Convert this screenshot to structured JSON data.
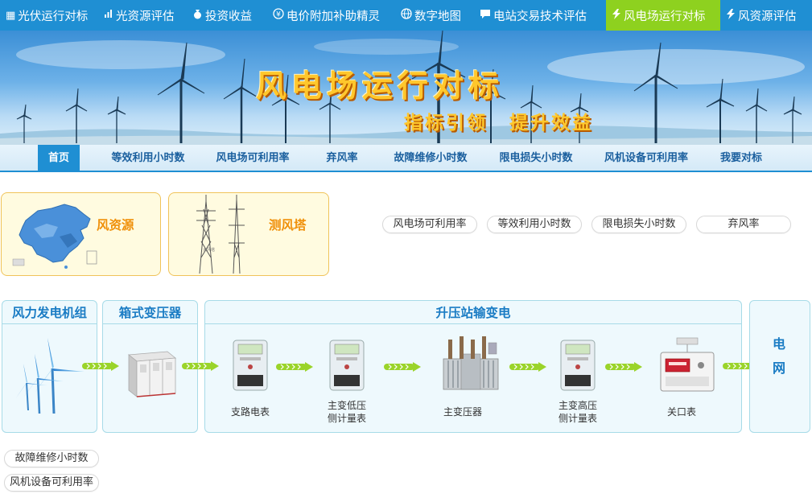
{
  "top_nav": {
    "items": [
      {
        "icon": "grid-icon",
        "glyph": "▦",
        "label": "光伏运行对标",
        "active": false
      },
      {
        "icon": "bar-chart-icon",
        "glyph": "📶",
        "label": "光资源评估",
        "active": false
      },
      {
        "icon": "money-bag-icon",
        "glyph": "♨",
        "label": "投资收益",
        "active": false
      },
      {
        "icon": "yen-circle-icon",
        "glyph": "¥",
        "label": "电价附加补助精灵",
        "active": false
      },
      {
        "icon": "globe-icon",
        "glyph": "⊕",
        "label": "数字地图",
        "active": false
      },
      {
        "icon": "chat-bubble-icon",
        "glyph": "▣",
        "label": "电站交易技术评估",
        "active": false
      },
      {
        "icon": "lightning-icon",
        "glyph": "⚡",
        "label": "风电场运行对标",
        "active": true
      },
      {
        "icon": "lightning-icon",
        "glyph": "⚡",
        "label": "风资源评估",
        "active": false
      }
    ]
  },
  "banner": {
    "title": "风电场运行对标",
    "subtitle": "指标引领 提升效益"
  },
  "sub_nav": {
    "items": [
      {
        "label": "首页",
        "active": true
      },
      {
        "label": "等效利用小时数",
        "active": false
      },
      {
        "label": "风电场可利用率",
        "active": false
      },
      {
        "label": "弃风率",
        "active": false
      },
      {
        "label": "故障维修小时数",
        "active": false
      },
      {
        "label": "限电损失小时数",
        "active": false
      },
      {
        "label": "风机设备可利用率",
        "active": false
      },
      {
        "label": "我要对标",
        "active": false
      }
    ]
  },
  "cards": {
    "wind_resource": "风资源",
    "wind_tower": "测风塔",
    "tower_caption": "大坪塔"
  },
  "pills": {
    "availability": "风电场可利用率",
    "equivalent_hours": "等效利用小时数",
    "curtailment_loss": "限电损失小时数",
    "abandon_rate": "弃风率",
    "fault_hours": "故障维修小时数",
    "equipment_availability": "风机设备可利用率"
  },
  "diagram": {
    "turbine_panel": "风力发电机组",
    "box_transformer_panel": "箱式变压器",
    "substation_panel": "升压站输变电",
    "grid_line1": "电",
    "grid_line2": "网",
    "devices": {
      "branch_meter": "支路电表",
      "low_side_meter_1": "主变低压",
      "low_side_meter_2": "侧计量表",
      "main_transformer": "主变压器",
      "high_side_meter_1": "主变高压",
      "high_side_meter_2": "侧计量表",
      "gateway_meter": "关口表"
    }
  },
  "colors": {
    "nav_blue": "#1f8fd3",
    "active_green": "#8ed11f",
    "card_border": "#f0c35a",
    "card_text": "#f0900a",
    "diagram_text": "#1a7cc4",
    "arrow_green": "#9ad42a"
  }
}
